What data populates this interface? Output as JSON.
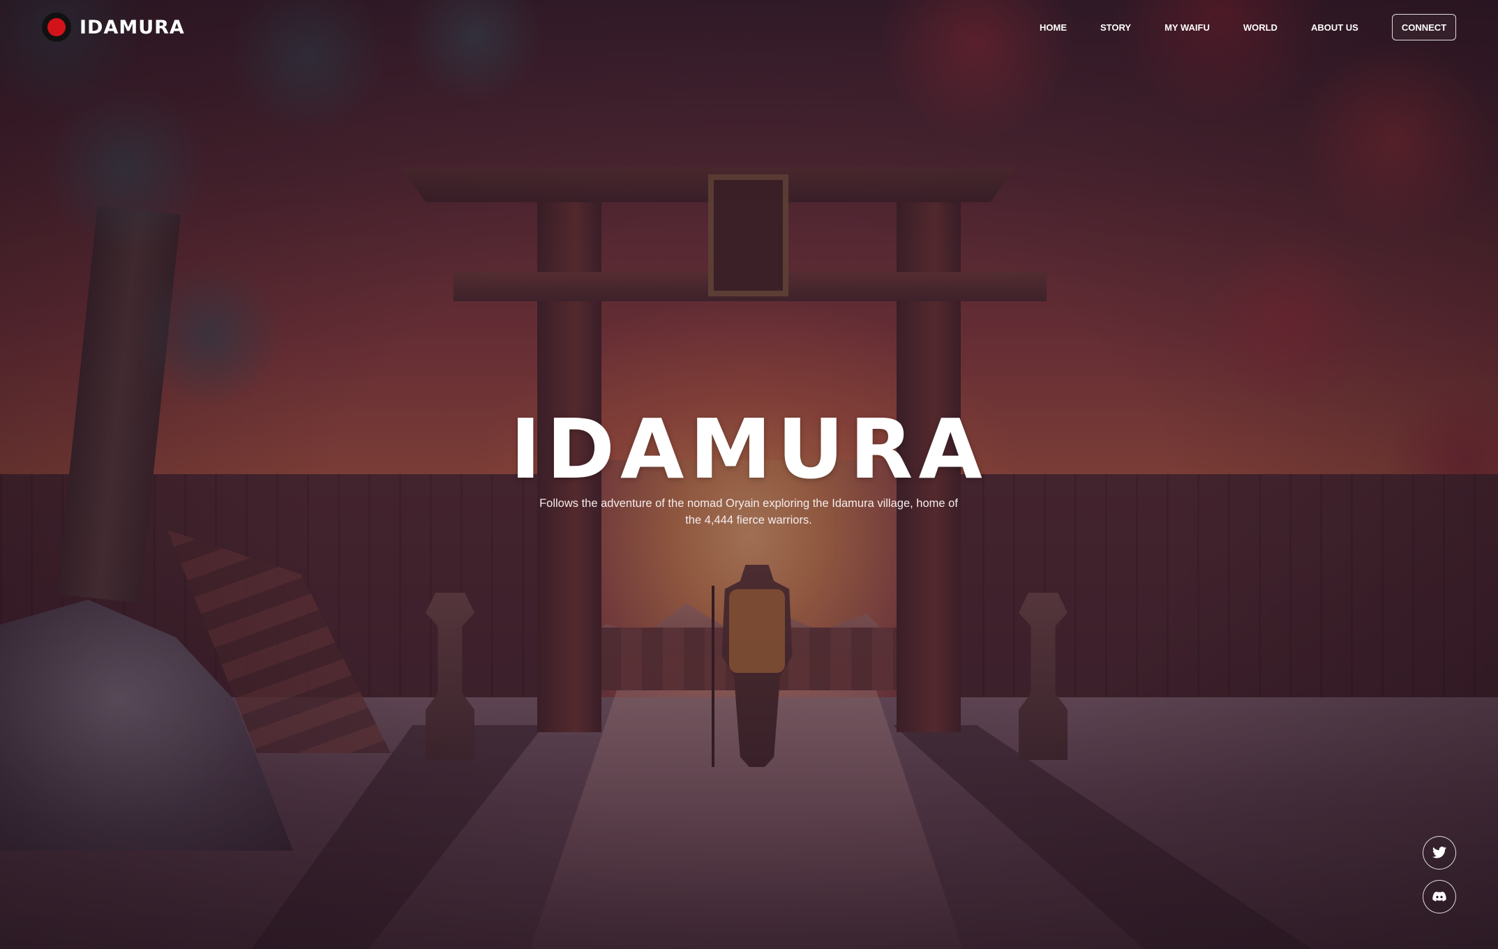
{
  "brand": {
    "name": "IDAMURA",
    "accent_color": "#d3131a"
  },
  "nav": {
    "items": [
      {
        "label": "HOME"
      },
      {
        "label": "STORY"
      },
      {
        "label": "MY WAIFU"
      },
      {
        "label": "WORLD"
      },
      {
        "label": "ABOUT US"
      }
    ],
    "connect_label": "CONNECT"
  },
  "hero": {
    "title": "IDAMURA",
    "subtitle": "Follows the adventure of the nomad Oryain exploring the Idamura village, home of the 4,444 fierce warriors."
  },
  "social": {
    "icons": [
      "twitter-icon",
      "discord-icon"
    ]
  }
}
